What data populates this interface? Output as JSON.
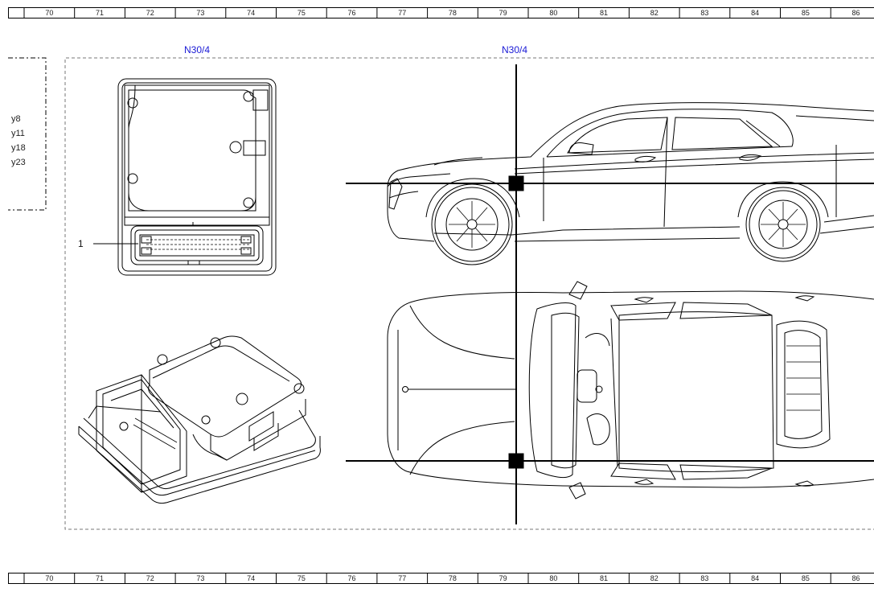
{
  "ruler": {
    "columns": [
      "70",
      "71",
      "72",
      "73",
      "74",
      "75",
      "76",
      "77",
      "78",
      "79",
      "80",
      "81",
      "82",
      "83",
      "84",
      "85",
      "86"
    ]
  },
  "labels": {
    "left_ref": "N30/4",
    "right_ref": "N30/4",
    "callout_1": "1"
  },
  "legend": {
    "items": [
      "y8",
      "y11",
      "y18",
      "y23"
    ]
  },
  "colors": {
    "ref_text": "#1a1ad6",
    "line": "#000000",
    "frame": "#888888"
  }
}
